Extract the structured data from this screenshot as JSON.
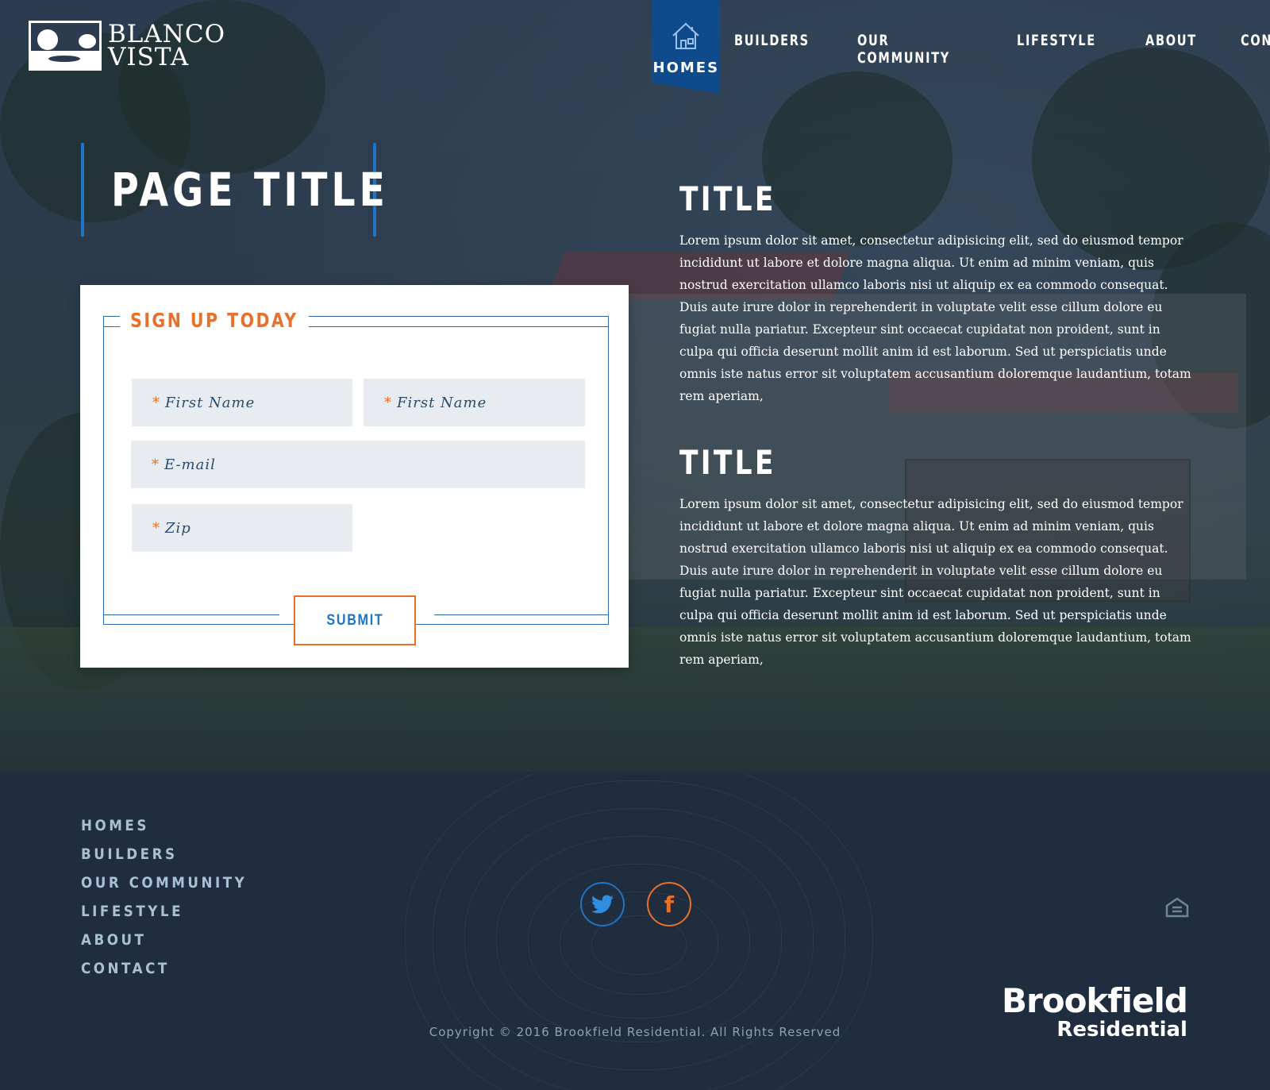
{
  "header": {
    "logo_line1": "BLANCO",
    "logo_line2": "VISTA",
    "nav": {
      "active": "HOMES",
      "items": [
        "BUILDERS",
        "OUR COMMUNITY",
        "LIFESTYLE",
        "ABOUT",
        "CONTACT"
      ]
    }
  },
  "page_title": "PAGE TITLE",
  "form": {
    "heading": "SIGN UP TODAY",
    "required_marker": "*",
    "first_name_1_placeholder": "First Name",
    "first_name_2_placeholder": "First Name",
    "email_placeholder": "E-mail",
    "zip_placeholder": "Zip",
    "submit_label": "SUBMIT"
  },
  "content": {
    "sections": [
      {
        "title": "TITLE",
        "body": "Lorem ipsum dolor sit amet, consectetur adipisicing elit, sed do eiusmod tempor incididunt ut labore et dolore magna aliqua. Ut enim ad minim veniam, quis nostrud exercitation ullamco laboris nisi ut aliquip ex ea commodo consequat. Duis aute irure dolor in reprehenderit in voluptate velit esse cillum dolore eu fugiat nulla pariatur. Excepteur sint occaecat cupidatat non proident, sunt in culpa qui officia deserunt mollit anim id est laborum. Sed ut perspiciatis unde omnis iste natus error sit voluptatem accusantium doloremque laudantium, totam rem aperiam,"
      },
      {
        "title": "TITLE",
        "body": "Lorem ipsum dolor sit amet, consectetur adipisicing elit, sed do eiusmod tempor incididunt ut labore et dolore magna aliqua. Ut enim ad minim veniam, quis nostrud exercitation ullamco laboris nisi ut aliquip ex ea commodo consequat. Duis aute irure dolor in reprehenderit in voluptate velit esse cillum dolore eu fugiat nulla pariatur. Excepteur sint occaecat cupidatat non proident, sunt in culpa qui officia deserunt mollit anim id est laborum. Sed ut perspiciatis unde omnis iste natus error sit voluptatem accusantium doloremque laudantium, totam rem aperiam,"
      }
    ]
  },
  "footer": {
    "nav": [
      "HOMES",
      "BUILDERS",
      "OUR COMMUNITY",
      "LIFESTYLE",
      "ABOUT",
      "CONTACT"
    ],
    "social": [
      "twitter-icon",
      "facebook-icon"
    ],
    "facebook_glyph": "f",
    "copyright": "Copyright © 2016 Brookfield Residential. All Rights Reserved",
    "brand_line1": "Brookfield",
    "brand_line2": "Residential"
  },
  "colors": {
    "accent_blue": "#1f74c4",
    "nav_active_bg": "#0f4a8c",
    "accent_orange": "#e8702a",
    "footer_bg": "#1f2d3e",
    "field_bg": "#e8ecf0"
  }
}
